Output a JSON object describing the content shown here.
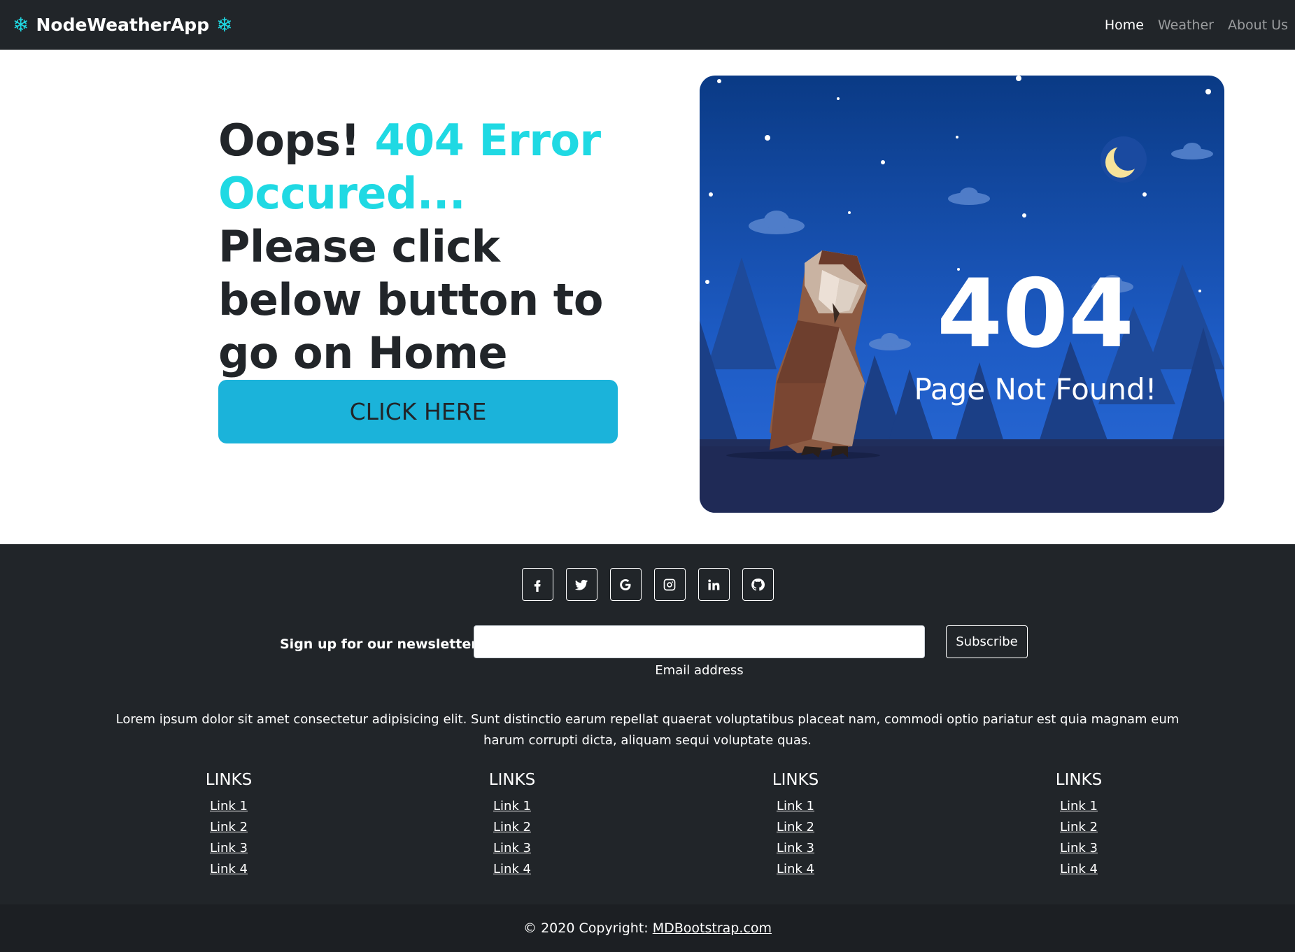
{
  "navbar": {
    "brand": "NodeWeatherApp",
    "items": [
      {
        "label": "Home",
        "active": true
      },
      {
        "label": "Weather",
        "active": false
      },
      {
        "label": "About Us",
        "active": false
      }
    ]
  },
  "hero": {
    "line1_plain": "Oops! ",
    "line1_accent": "404 Error Occured...",
    "line2": "Please click below button to go on Home page.",
    "button_label": "CLICK HERE",
    "illustration": {
      "number": "404",
      "caption": "Page Not Found!"
    }
  },
  "footer": {
    "socials": [
      "facebook-icon",
      "twitter-icon",
      "google-icon",
      "instagram-icon",
      "linkedin-icon",
      "github-icon"
    ],
    "newsletter": {
      "label": "Sign up for our newsletter",
      "input_value": "",
      "hint": "Email address",
      "button": "Subscribe"
    },
    "text": "Lorem ipsum dolor sit amet consectetur adipisicing elit. Sunt distinctio earum repellat quaerat voluptatibus placeat nam, commodi optio pariatur est quia magnam eum harum corrupti dicta, aliquam sequi voluptate quas.",
    "columns": [
      {
        "title": "LINKS",
        "links": [
          "Link 1",
          "Link 2",
          "Link 3",
          "Link 4"
        ]
      },
      {
        "title": "LINKS",
        "links": [
          "Link 1",
          "Link 2",
          "Link 3",
          "Link 4"
        ]
      },
      {
        "title": "LINKS",
        "links": [
          "Link 1",
          "Link 2",
          "Link 3",
          "Link 4"
        ]
      },
      {
        "title": "LINKS",
        "links": [
          "Link 1",
          "Link 2",
          "Link 3",
          "Link 4"
        ]
      }
    ],
    "copyright": {
      "prefix": "© 2020 Copyright:",
      "link": "MDBootstrap.com"
    }
  },
  "colors": {
    "accent": "#1fd9e3",
    "button": "#1bb3da",
    "dark": "#212529"
  }
}
